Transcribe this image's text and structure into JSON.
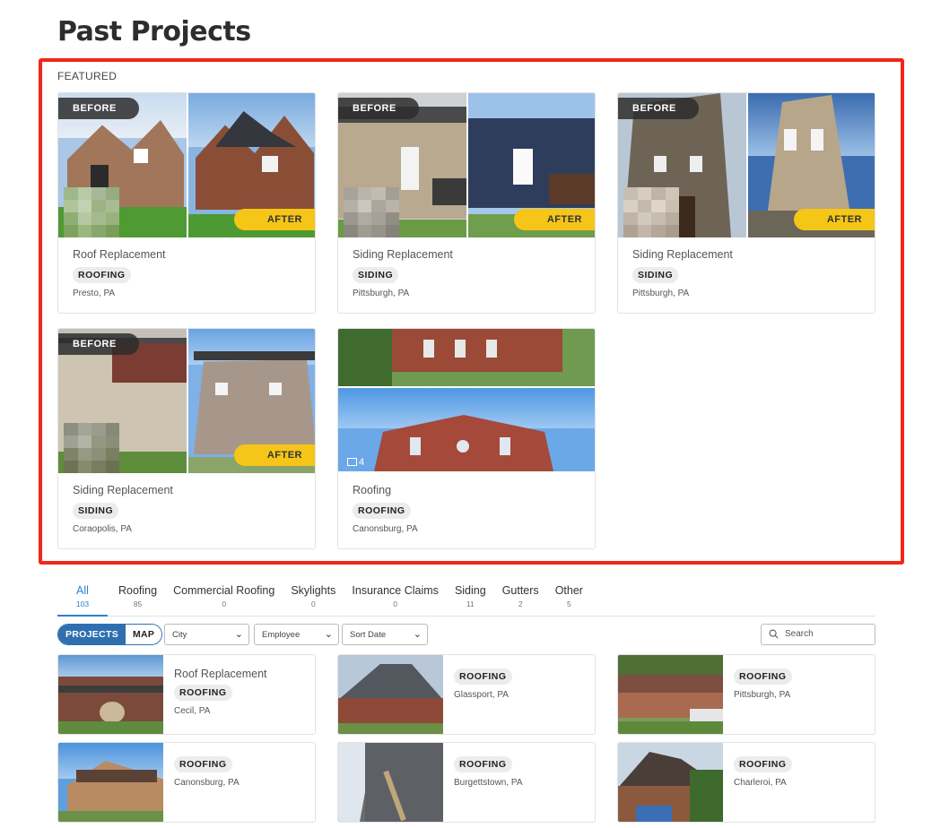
{
  "page": {
    "title": "Past Projects"
  },
  "featured": {
    "label": "FEATURED",
    "before_label": "BEFORE",
    "after_label": "AFTER",
    "cards": [
      {
        "title": "Roof Replacement",
        "tag": "ROOFING",
        "location": "Presto, PA"
      },
      {
        "title": "Siding Replacement",
        "tag": "SIDING",
        "location": "Pittsburgh, PA"
      },
      {
        "title": "Siding Replacement",
        "tag": "SIDING",
        "location": "Pittsburgh, PA"
      },
      {
        "title": "Siding Replacement",
        "tag": "SIDING",
        "location": "Coraopolis, PA"
      },
      {
        "title": "Roofing",
        "tag": "ROOFING",
        "location": "Canonsburg, PA",
        "photo_count": "4"
      }
    ]
  },
  "tabs": [
    {
      "label": "All",
      "count": "103",
      "active": true
    },
    {
      "label": "Roofing",
      "count": "85"
    },
    {
      "label": "Commercial Roofing",
      "count": "0"
    },
    {
      "label": "Skylights",
      "count": "0"
    },
    {
      "label": "Insurance Claims",
      "count": "0"
    },
    {
      "label": "Siding",
      "count": "11"
    },
    {
      "label": "Gutters",
      "count": "2"
    },
    {
      "label": "Other",
      "count": "5"
    }
  ],
  "controls": {
    "projects_label": "PROJECTS",
    "map_label": "MAP",
    "city_select": "City",
    "employee_select": "Employee",
    "sort_select": "Sort Date",
    "search_placeholder": "Search"
  },
  "projects": [
    {
      "title": "Roof Replacement",
      "tag": "ROOFING",
      "location": "Cecil, PA"
    },
    {
      "title": "",
      "tag": "ROOFING",
      "location": "Glassport, PA"
    },
    {
      "title": "",
      "tag": "ROOFING",
      "location": "Pittsburgh, PA"
    },
    {
      "title": "",
      "tag": "ROOFING",
      "location": "Canonsburg, PA"
    },
    {
      "title": "",
      "tag": "ROOFING",
      "location": "Burgettstown, PA"
    },
    {
      "title": "",
      "tag": "ROOFING",
      "location": "Charleroi, PA"
    }
  ],
  "colors": {
    "accent": "#2f7fd1",
    "highlight_frame": "#f2261a",
    "after_badge": "#f5c518"
  }
}
